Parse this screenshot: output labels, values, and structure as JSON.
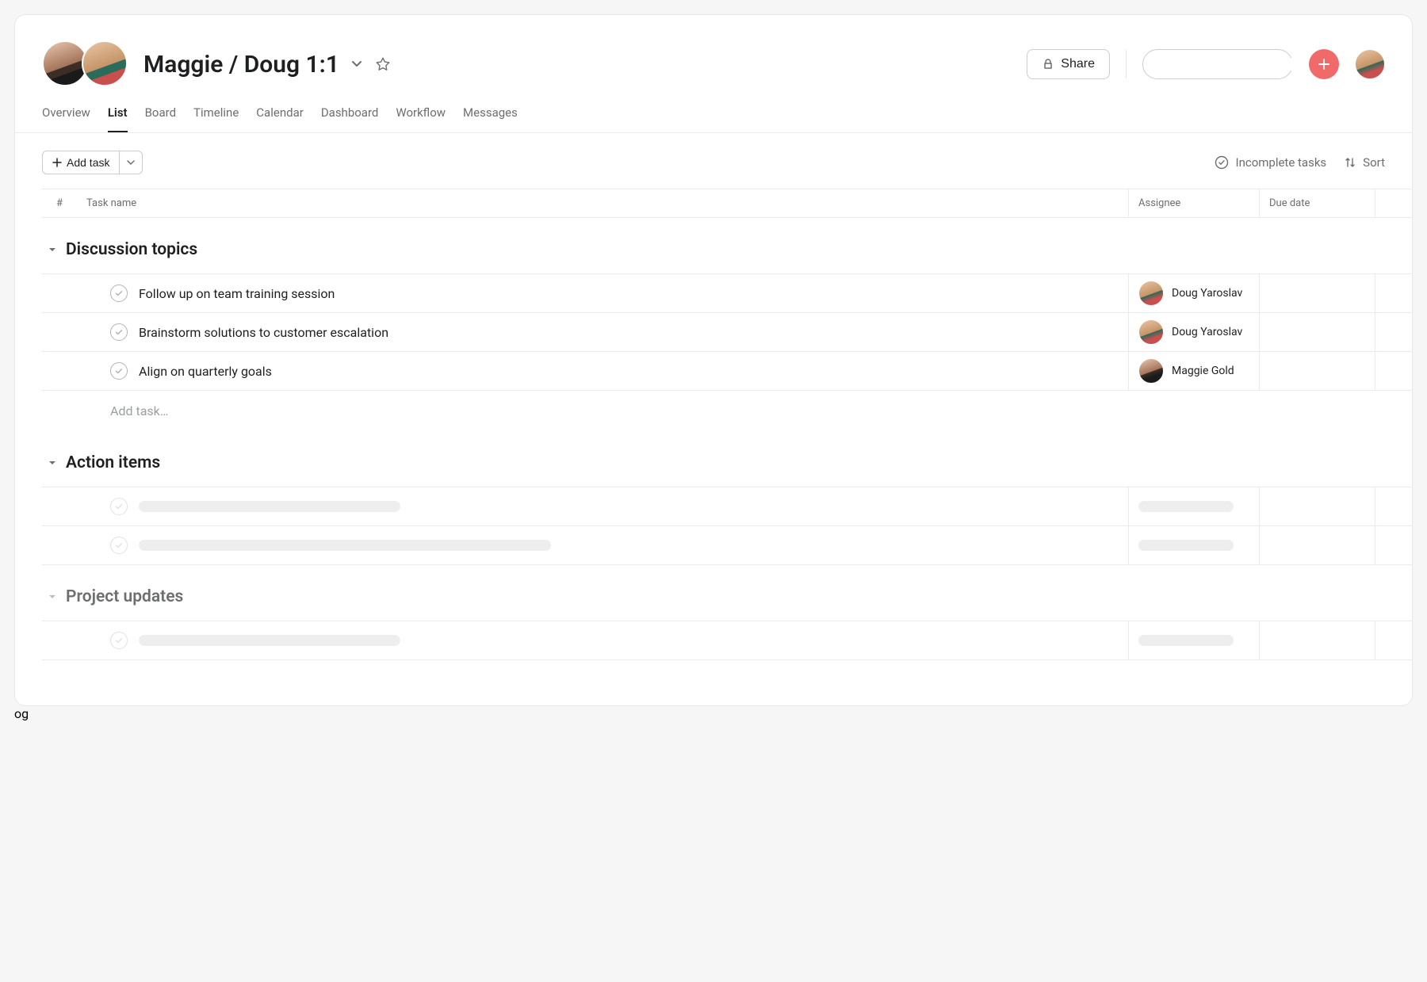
{
  "header": {
    "title": "Maggie / Doug 1:1",
    "share_label": "Share",
    "search_placeholder": ""
  },
  "tabs": [
    {
      "label": "Overview",
      "active": false
    },
    {
      "label": "List",
      "active": true
    },
    {
      "label": "Board",
      "active": false
    },
    {
      "label": "Timeline",
      "active": false
    },
    {
      "label": "Calendar",
      "active": false
    },
    {
      "label": "Dashboard",
      "active": false
    },
    {
      "label": "Workflow",
      "active": false
    },
    {
      "label": "Messages",
      "active": false
    }
  ],
  "toolbar": {
    "add_task_label": "Add task",
    "filter_incomplete_label": "Incomplete tasks",
    "sort_label": "Sort"
  },
  "columns": {
    "num": "#",
    "task_name": "Task name",
    "assignee": "Assignee",
    "due_date": "Due date"
  },
  "sections": [
    {
      "title": "Discussion topics",
      "tasks": [
        {
          "name": "Follow up on team training session",
          "assignee": "Doug Yaroslav",
          "assignee_avatar": "doug"
        },
        {
          "name": "Brainstorm solutions to customer escalation",
          "assignee": "Doug Yaroslav",
          "assignee_avatar": "doug"
        },
        {
          "name": "Align on quarterly goals",
          "assignee": "Maggie Gold",
          "assignee_avatar": "maggie"
        }
      ],
      "add_task_label": "Add task…"
    },
    {
      "title": "Action items",
      "placeholders": [
        {
          "name_width": 330,
          "has_assignee": true
        },
        {
          "name_width": 520,
          "has_assignee": true
        }
      ]
    },
    {
      "title": "Project updates",
      "muted": true,
      "placeholders": [
        {
          "name_width": 330,
          "has_assignee": true
        }
      ]
    }
  ]
}
